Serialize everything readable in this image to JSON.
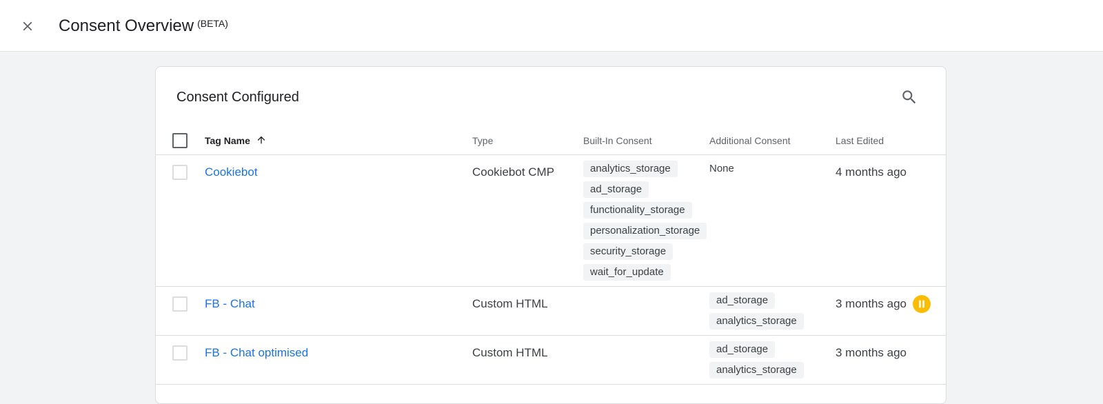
{
  "header": {
    "title": "Consent Overview",
    "badge": "(BETA)",
    "close_icon": "close-icon"
  },
  "card": {
    "title": "Consent Configured",
    "search_icon": "search-icon"
  },
  "table": {
    "columns": {
      "tag_name": "Tag Name",
      "type": "Type",
      "built_in": "Built-In Consent",
      "additional": "Additional Consent",
      "last_edited": "Last Edited"
    },
    "sort_icon": "arrow-up-icon",
    "rows": [
      {
        "name": "Cookiebot",
        "type": "Cookiebot CMP",
        "built_in": [
          "analytics_storage",
          "ad_storage",
          "functionality_storage",
          "personalization_storage",
          "security_storage",
          "wait_for_update"
        ],
        "additional_text": "None",
        "additional": [],
        "last_edited": "4 months ago",
        "paused": false
      },
      {
        "name": "FB - Chat",
        "type": "Custom HTML",
        "built_in": [],
        "additional_text": "",
        "additional": [
          "ad_storage",
          "analytics_storage"
        ],
        "last_edited": "3 months ago",
        "paused": true
      },
      {
        "name": "FB - Chat optimised",
        "type": "Custom HTML",
        "built_in": [],
        "additional_text": "",
        "additional": [
          "ad_storage",
          "analytics_storage"
        ],
        "last_edited": "3 months ago",
        "paused": false
      }
    ]
  },
  "colors": {
    "link": "#1a73e8",
    "paused": "#fbbc04"
  }
}
